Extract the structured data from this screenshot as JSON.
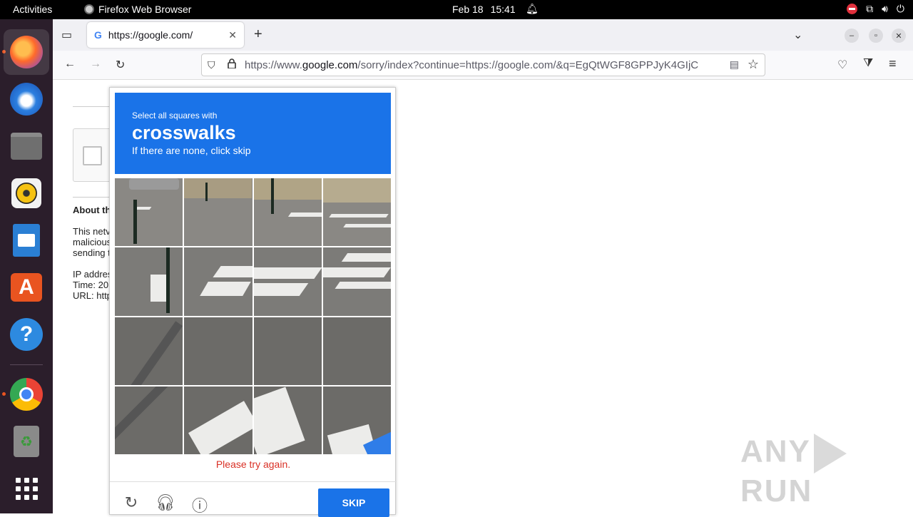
{
  "topbar": {
    "activities": "Activities",
    "app_name": "Firefox Web Browser",
    "date": "Feb 18",
    "time": "15:41"
  },
  "dock": {
    "items": [
      "firefox-icon",
      "thunderbird-icon",
      "files-icon",
      "rhythmbox-icon",
      "libreoffice-impress-icon",
      "app-center-icon",
      "help-icon",
      "chrome-icon",
      "trash-icon",
      "app-grid-icon"
    ]
  },
  "browser": {
    "tab_title": "https://google.com/",
    "url_prefix": "https://www.",
    "url_domain": "google.com",
    "url_rest": "/sorry/index?continue=https://google.com/&q=EgQtWGF8GPPJyK4GIjC"
  },
  "page": {
    "about_heading": "About th",
    "para_line1": "This netv",
    "para_line2": "malicious",
    "para_line3": "sending t",
    "ip_line": "IP addres",
    "time_line": "Time: 20",
    "url_line": "URL: http"
  },
  "captcha": {
    "instruction": "Select all squares with",
    "target": "crosswalks",
    "hint": "If there are none, click skip",
    "error": "Please try again.",
    "skip_label": "SKIP",
    "accent": "#1a73e8",
    "error_color": "#d93025"
  },
  "watermark": {
    "left": "ANY",
    "right": "RUN"
  }
}
